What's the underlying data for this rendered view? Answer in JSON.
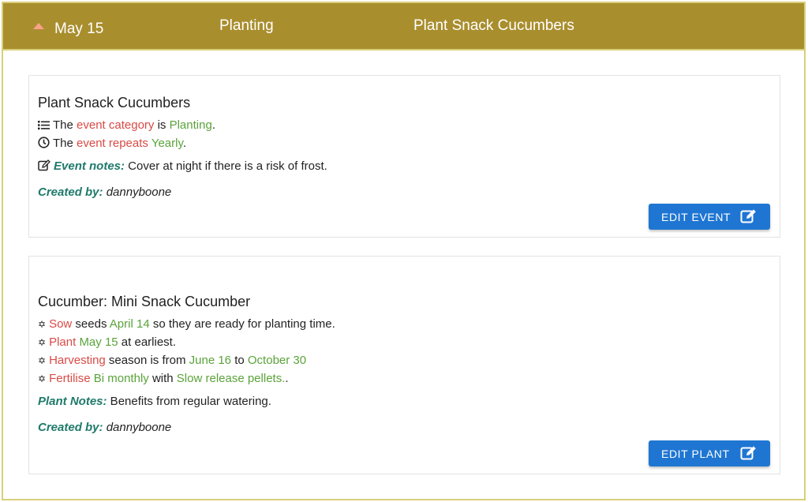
{
  "header": {
    "date": "May 15",
    "category": "Planting",
    "title": "Plant Snack Cucumbers"
  },
  "event_card": {
    "title": "Plant Snack Cucumbers",
    "category_line": {
      "prefix": "The ",
      "term": "event category",
      "mid": " is ",
      "value": "Planting",
      "suffix": "."
    },
    "repeat_line": {
      "prefix": "The ",
      "term": "event repeats",
      "mid": " ",
      "value": "Yearly",
      "suffix": "."
    },
    "notes_label": "Event notes:",
    "notes_text": " Cover at night if there is a risk of frost.",
    "created_label": "Created by:",
    "created_by": " dannyboone",
    "edit_button": "EDIT EVENT"
  },
  "plant_card": {
    "title": "Cucumber: Mini Snack Cucumber",
    "sow": {
      "term": "Sow",
      "mid": " seeds ",
      "value": "April 14",
      "suffix": " so they are ready for planting time."
    },
    "plant": {
      "term": "Plant",
      "mid": " ",
      "value": "May 15",
      "suffix": " at earliest."
    },
    "harvest": {
      "term": "Harvesting",
      "mid": " season is from ",
      "value1": "June 16",
      "mid2": " to ",
      "value2": "October 30"
    },
    "fertilise": {
      "term": "Fertilise",
      "mid": " ",
      "value1": "Bi monthly",
      "mid2": " with ",
      "value2": "Slow release pellets.",
      "suffix": "."
    },
    "notes_label": "Plant Notes:",
    "notes_text": " Benefits from regular watering.",
    "created_label": "Created by:",
    "created_by": " dannyboone",
    "edit_button": "EDIT PLANT"
  },
  "colors": {
    "header_bg": "#a98e2e",
    "term": "#d94a45",
    "value": "#5aa33a",
    "label": "#1f7a6b",
    "button": "#1f76d2"
  },
  "icons": [
    "caret-up-icon",
    "list-icon",
    "clock-icon",
    "edit-note-icon",
    "star-of-david-icon",
    "edit-icon"
  ]
}
